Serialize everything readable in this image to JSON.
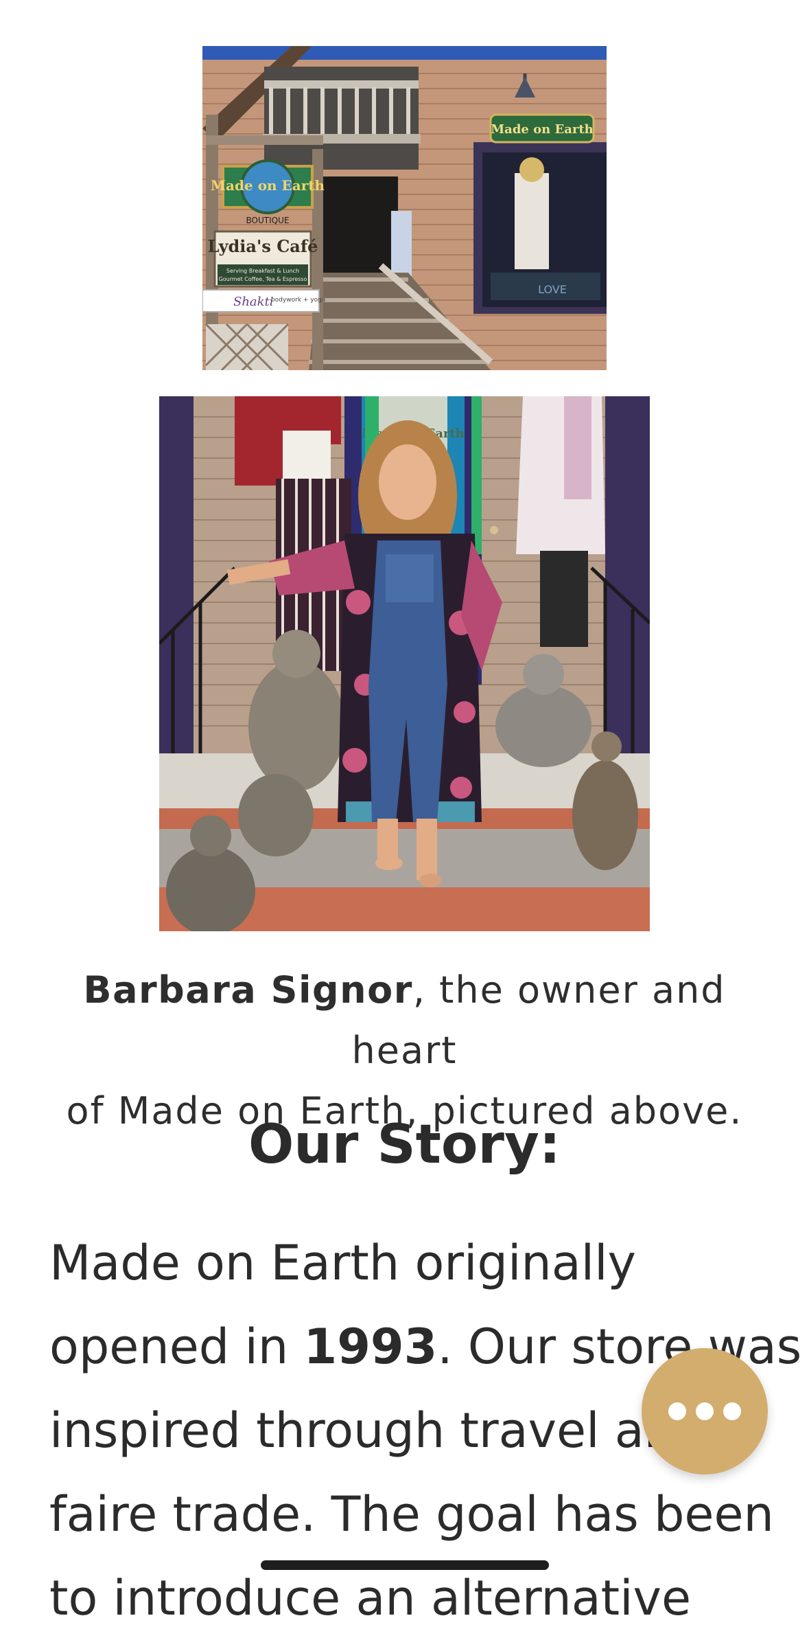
{
  "storefront_photo": {
    "signs": {
      "boutique_name": "Made on Earth",
      "boutique_sub": "BOUTIQUE",
      "cafe_name": "Lydia's Café",
      "cafe_sub": "Serving Breakfast & Lunch",
      "cafe_sub2": "Gourmet Coffee, Tea & Espresso",
      "shakti": "Shakti",
      "shakti_sub": "bodywork + yoga",
      "window_sign": "Made on Earth",
      "window_word": "LOVE"
    }
  },
  "owner_photo": {
    "window_text": "Made on Earth"
  },
  "caption": {
    "name": "Barbara Signor",
    "rest_line1": ", the owner and heart",
    "line2": "of Made on Earth, pictured above."
  },
  "story": {
    "heading": "Our Story:",
    "line1": "Made on Earth originally",
    "line2_before": "opened in ",
    "year": "1993",
    "line2_after": ".  Our store was",
    "line3": "inspired through travel and",
    "line4": "faire trade.  The goal has been",
    "line5": "to introduce an alternative"
  },
  "fab": {
    "icon": "more-horizontal-icon"
  },
  "colors": {
    "fab": "#d3ad6e",
    "text": "#2b2b2b",
    "background": "#ffffff"
  }
}
